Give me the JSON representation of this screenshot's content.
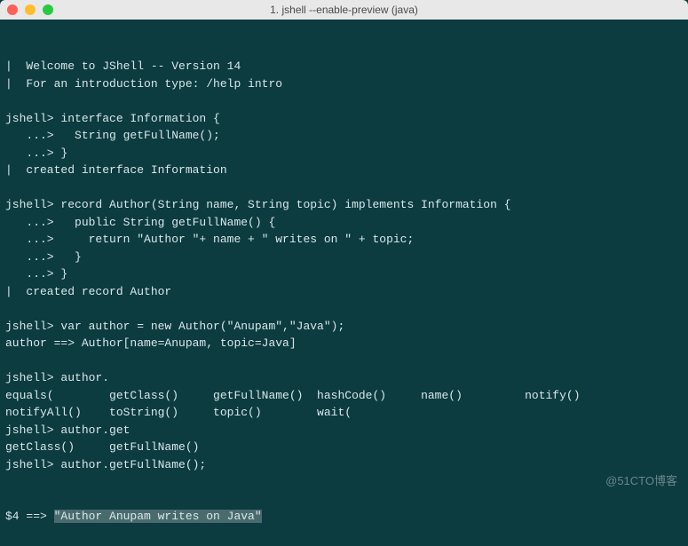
{
  "window": {
    "title": "1. jshell --enable-preview (java)"
  },
  "terminal": {
    "lines": [
      "|  Welcome to JShell -- Version 14",
      "|  For an introduction type: /help intro",
      "",
      "jshell> interface Information {",
      "   ...>   String getFullName();",
      "   ...> }",
      "|  created interface Information",
      "",
      "jshell> record Author(String name, String topic) implements Information {",
      "   ...>   public String getFullName() {",
      "   ...>     return \"Author \"+ name + \" writes on \" + topic;",
      "   ...>   }",
      "   ...> }",
      "|  created record Author",
      "",
      "jshell> var author = new Author(\"Anupam\",\"Java\");",
      "author ==> Author[name=Anupam, topic=Java]",
      "",
      "jshell> author.",
      "equals(        getClass()     getFullName()  hashCode()     name()         notify()",
      "notifyAll()    toString()     topic()        wait(",
      "jshell> author.get",
      "getClass()     getFullName()",
      "jshell> author.getFullName();"
    ],
    "result_prefix": "$4 ==> ",
    "result_highlight": "\"Author Anupam writes on Java\""
  },
  "watermark": "@51CTO博客"
}
